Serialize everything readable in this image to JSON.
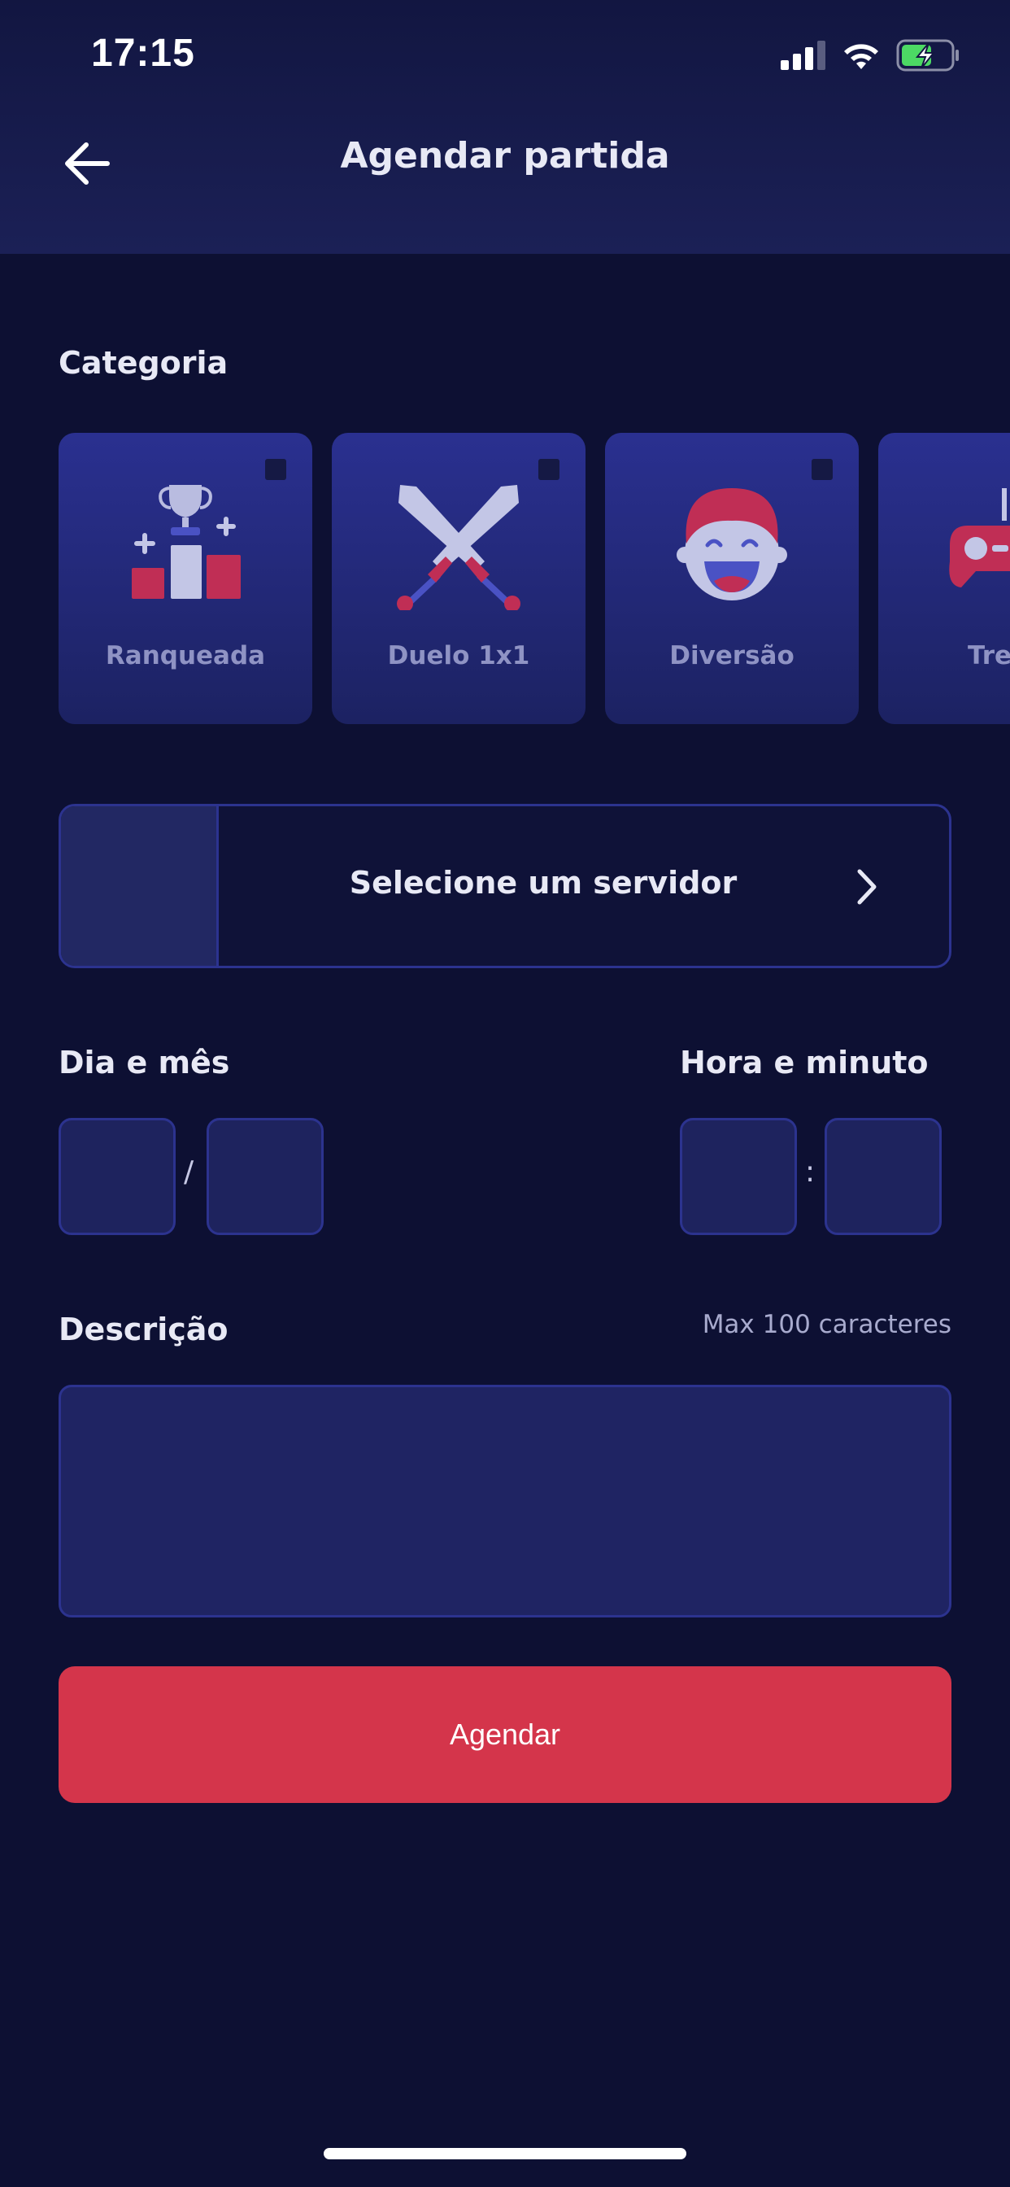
{
  "status_bar": {
    "time": "17:15"
  },
  "header": {
    "title": "Agendar partida"
  },
  "category": {
    "label": "Categoria",
    "items": [
      {
        "label": "Ranqueada",
        "icon": "trophy-podium-icon"
      },
      {
        "label": "Duelo 1x1",
        "icon": "crossed-swords-icon"
      },
      {
        "label": "Diversão",
        "icon": "laughing-face-icon"
      },
      {
        "label": "Trei",
        "icon": "gamepad-icon"
      }
    ]
  },
  "server": {
    "placeholder": "Selecione um servidor"
  },
  "date": {
    "label": "Dia e mês",
    "separator": "/"
  },
  "time": {
    "label": "Hora e minuto",
    "separator": ":"
  },
  "description": {
    "label": "Descrição",
    "hint": "Max 100 caracteres"
  },
  "submit": {
    "label": "Agendar"
  },
  "colors": {
    "background": "#0d1033",
    "card": "#252b80",
    "accent": "#d4354b",
    "border": "#2c338f"
  }
}
